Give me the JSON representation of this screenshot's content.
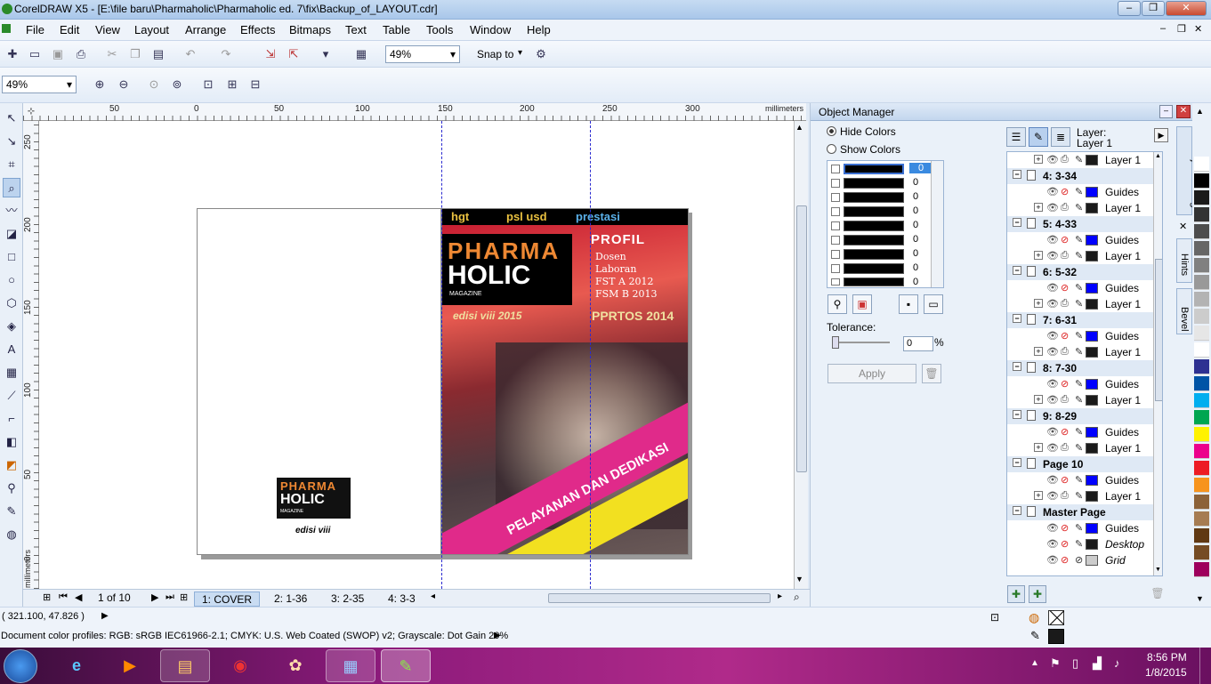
{
  "window": {
    "title": "CorelDRAW X5 - [E:\\file baru\\Pharmaholic\\Pharmaholic ed. 7\\fix\\Backup_of_LAYOUT.cdr]"
  },
  "menu": [
    "File",
    "Edit",
    "View",
    "Layout",
    "Arrange",
    "Effects",
    "Bitmaps",
    "Text",
    "Table",
    "Tools",
    "Window",
    "Help"
  ],
  "toolbar": {
    "zoom_value": "49%",
    "snap_label": "Snap to"
  },
  "propertybar": {
    "zoom_value": "49%"
  },
  "ruler": {
    "h_labels": [
      "50",
      "0",
      "50",
      "100",
      "150",
      "200",
      "250",
      "300",
      "millimeters"
    ],
    "v_labels": [
      "250",
      "200",
      "150",
      "100",
      "50",
      "0",
      "millimeters"
    ]
  },
  "pages": {
    "nav_text": "1 of 10",
    "tabs": [
      "1: COVER",
      "2: 1-36",
      "3: 2-35",
      "4: 3-3"
    ]
  },
  "back_cover": {
    "logo_top": "PHARMA",
    "logo_bottom": "HOLIC",
    "logo_sub": "MAGAZINE",
    "edition": "edisi viii"
  },
  "cover": {
    "topline": [
      "hgt",
      "psl usd",
      "prestasi"
    ],
    "logo_top": "PHARMA",
    "logo_bottom": "HOLIC",
    "logo_sub": "MAGAZINE",
    "edition": "edisi viii 2015",
    "profil_title": "PROFIL",
    "profil_items": [
      "Dosen",
      "Laboran",
      "FST A 2012",
      "FSM B 2013"
    ],
    "event": "PPRTOS 2014",
    "banner": "PELAYANAN DAN DEDIKASI"
  },
  "docker": {
    "title": "Object Manager",
    "hide_colors": "Hide Colors",
    "show_colors": "Show Colors",
    "swatch_values": [
      "0",
      "0",
      "0",
      "0",
      "0",
      "0",
      "0",
      "0",
      "0"
    ],
    "tolerance_label": "Tolerance:",
    "tolerance_value": "0",
    "tolerance_unit": "%",
    "apply_label": "Apply",
    "layer_caption": "Layer:",
    "layer_name": "Layer 1",
    "tree": [
      {
        "kind": "layer",
        "label": "Layer 1"
      },
      {
        "kind": "page",
        "label": "4: 3-34"
      },
      {
        "kind": "layer",
        "label": "Guides",
        "color": "#0000ff"
      },
      {
        "kind": "layer",
        "label": "Layer 1"
      },
      {
        "kind": "page",
        "label": "5: 4-33"
      },
      {
        "kind": "layer",
        "label": "Guides",
        "color": "#0000ff"
      },
      {
        "kind": "layer",
        "label": "Layer 1"
      },
      {
        "kind": "page",
        "label": "6: 5-32"
      },
      {
        "kind": "layer",
        "label": "Guides",
        "color": "#0000ff"
      },
      {
        "kind": "layer",
        "label": "Layer 1"
      },
      {
        "kind": "page",
        "label": "7: 6-31"
      },
      {
        "kind": "layer",
        "label": "Guides",
        "color": "#0000ff"
      },
      {
        "kind": "layer",
        "label": "Layer 1"
      },
      {
        "kind": "page",
        "label": "8: 7-30"
      },
      {
        "kind": "layer",
        "label": "Guides",
        "color": "#0000ff"
      },
      {
        "kind": "layer",
        "label": "Layer 1"
      },
      {
        "kind": "page",
        "label": "9: 8-29"
      },
      {
        "kind": "layer",
        "label": "Guides",
        "color": "#0000ff"
      },
      {
        "kind": "layer",
        "label": "Layer 1"
      },
      {
        "kind": "page",
        "label": "Page 10"
      },
      {
        "kind": "layer",
        "label": "Guides",
        "color": "#0000ff"
      },
      {
        "kind": "layer",
        "label": "Layer 1"
      },
      {
        "kind": "page",
        "label": "Master Page"
      },
      {
        "kind": "layer",
        "label": "Guides",
        "color": "#0000ff"
      },
      {
        "kind": "layer",
        "label": "Desktop",
        "italic": true
      },
      {
        "kind": "layer",
        "label": "Grid",
        "italic": true,
        "color": "#cccccc"
      }
    ],
    "side_tabs": [
      "Object Manager",
      "Hints",
      "Bevel"
    ]
  },
  "palette": [
    "#ffffff",
    "#000000",
    "#1a1a1a",
    "#333333",
    "#4d4d4d",
    "#666666",
    "#808080",
    "#999999",
    "#b3b3b3",
    "#cccccc",
    "#e6e6e6",
    "#ffffff",
    "#2e3192",
    "#0054a6",
    "#00aeef",
    "#00a651",
    "#fff200",
    "#ec008c",
    "#ed1c24",
    "#f7941d",
    "#8c6239",
    "#a67c52",
    "#603913",
    "#754c24",
    "#9e005d"
  ],
  "status": {
    "coords": "( 321.100, 47.826 )",
    "color_profiles": "Document color profiles: RGB: sRGB IEC61966-2.1; CMYK: U.S. Web Coated (SWOP) v2; Grayscale: Dot Gain 20%"
  },
  "taskbar": {
    "time": "8:56 PM",
    "date": "1/8/2015"
  }
}
